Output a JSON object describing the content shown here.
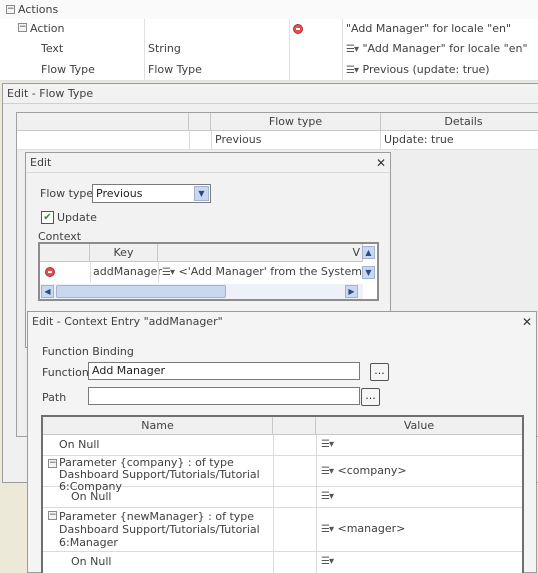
{
  "grid": {
    "rows": [
      {
        "name": "Actions"
      },
      {
        "name": "Action",
        "value": "\"Add Manager\" for locale \"en\""
      },
      {
        "name": "Text",
        "type": "String",
        "value": "\"Add Manager\" for locale \"en\""
      },
      {
        "name": "Flow Type",
        "type": "Flow Type",
        "value": "Previous (update: true)"
      }
    ]
  },
  "flowtype_dialog": {
    "title": "Edit - Flow Type",
    "columns": [
      "Flow type",
      "Details"
    ],
    "row": {
      "flow_type": "Previous",
      "details": "Update: true"
    }
  },
  "edit_dialog": {
    "title": "Edit",
    "close": "✕",
    "flow_type_label": "Flow type",
    "flow_type_value": "Previous",
    "update_label": "Update",
    "update_checked": true,
    "context_label": "Context",
    "context_columns": [
      "Key",
      "V"
    ],
    "context_row": {
      "key": "addManager",
      "value": "<'Add Manager' from the System mod"
    }
  },
  "context_entry_dialog": {
    "title": "Edit - Context Entry \"addManager\"",
    "close": "✕",
    "section": "Function Binding",
    "function_label": "Function",
    "function_value": "Add Manager",
    "path_label": "Path",
    "path_value": "",
    "browse": "...",
    "table_columns": [
      "Name",
      "Value"
    ],
    "table_rows": [
      {
        "name": "On Null",
        "value": ""
      },
      {
        "name": "Parameter {company} : of type Dashboard Support/Tutorials/Tutorial 6:Company",
        "value": "<company>"
      },
      {
        "name": "On Null",
        "value": ""
      },
      {
        "name": "Parameter {newManager} : of type Dashboard Support/Tutorials/Tutorial 6:Manager",
        "value": "<manager>"
      },
      {
        "name": "On Null",
        "value": ""
      }
    ]
  },
  "colors": {
    "delete": "#e05050",
    "scroll": "#c9d8ef",
    "check": "#3a8a3a"
  }
}
